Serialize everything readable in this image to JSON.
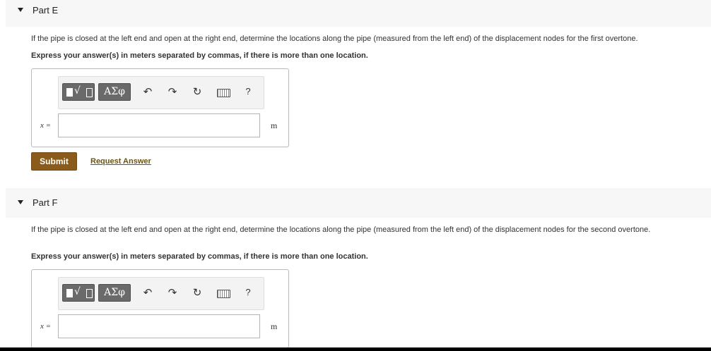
{
  "parts": [
    {
      "title": "Part E",
      "question": "If the pipe is closed at the left end and open at the right end, determine the locations along the pipe (measured from the left end) of the displacement nodes for the first overtone.",
      "instruction": "Express your answer(s) in meters separated by commas, if there is more than one location.",
      "toolbar": {
        "greek_label": "ΑΣφ",
        "help_label": "?"
      },
      "variable": "x =",
      "input_value": "",
      "unit": "m",
      "submit_label": "Submit",
      "request_answer_label": "Request Answer"
    },
    {
      "title": "Part F",
      "question": "If the pipe is closed at the left end and open at the right end, determine the locations along the pipe (measured from the left end) of the displacement nodes for the second overtone.",
      "instruction": "Express your answer(s) in meters separated by commas, if there is more than one location.",
      "toolbar": {
        "greek_label": "ΑΣφ",
        "help_label": "?"
      },
      "variable": "x =",
      "input_value": "",
      "unit": "m"
    }
  ],
  "icons": [
    "caret-down-icon",
    "templates-icon",
    "undo-icon",
    "redo-icon",
    "reset-icon",
    "keyboard-icon",
    "help-icon"
  ]
}
